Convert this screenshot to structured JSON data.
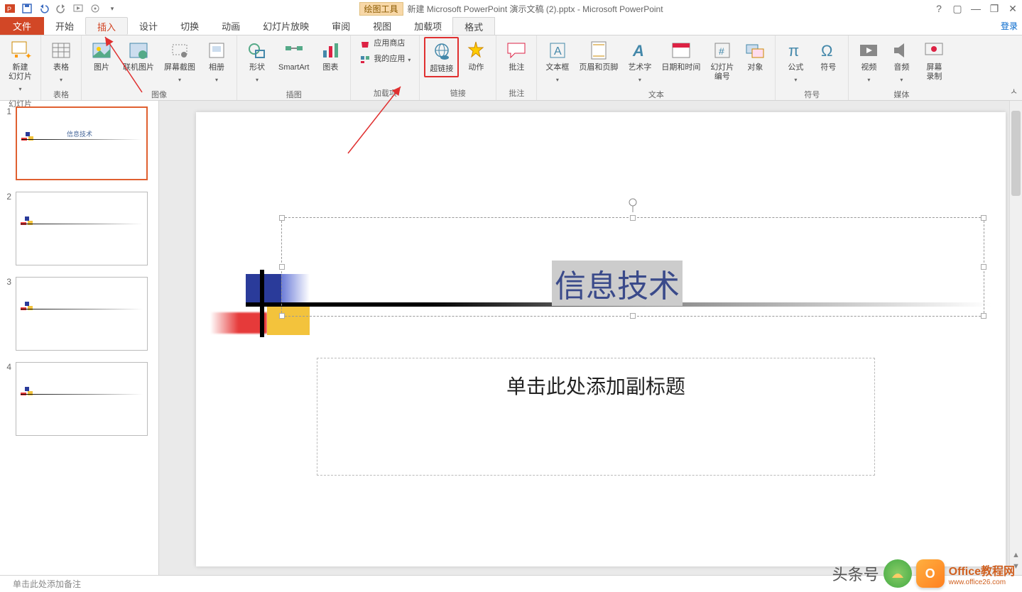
{
  "titlebar": {
    "contextual_label": "绘图工具",
    "doc_title": "新建 Microsoft PowerPoint 演示文稿 (2).pptx - Microsoft PowerPoint"
  },
  "tabs": {
    "file": "文件",
    "home": "开始",
    "insert": "插入",
    "design": "设计",
    "transitions": "切换",
    "animations": "动画",
    "slideshow": "幻灯片放映",
    "review": "审阅",
    "view": "视图",
    "addins": "加载项",
    "format": "格式",
    "login": "登录"
  },
  "ribbon": {
    "groups": {
      "slides": {
        "label": "幻灯片",
        "new_slide": "新建\n幻灯片"
      },
      "tables": {
        "label": "表格",
        "table": "表格"
      },
      "images": {
        "label": "图像",
        "picture": "图片",
        "online_picture": "联机图片",
        "screenshot": "屏幕截图",
        "album": "相册"
      },
      "illustrations": {
        "label": "插图",
        "shapes": "形状",
        "smartart": "SmartArt",
        "chart": "图表"
      },
      "addins": {
        "label": "加载项",
        "store": "应用商店",
        "myapps": "我的应用"
      },
      "links": {
        "label": "链接",
        "hyperlink": "超链接",
        "action": "动作"
      },
      "comments": {
        "label": "批注",
        "comment": "批注"
      },
      "text": {
        "label": "文本",
        "textbox": "文本框",
        "headerfooter": "页眉和页脚",
        "wordart": "艺术字",
        "datetime": "日期和时间",
        "slidenumber": "幻灯片\n编号",
        "object": "对象"
      },
      "symbols": {
        "label": "符号",
        "equation": "公式",
        "symbol": "符号"
      },
      "media": {
        "label": "媒体",
        "video": "视频",
        "audio": "音频",
        "screenrec": "屏幕\n录制"
      }
    }
  },
  "slide": {
    "title_text": "信息技术",
    "subtitle_placeholder": "单击此处添加副标题",
    "thumb_title": "信息技术"
  },
  "thumbs": {
    "count": 4,
    "numbers": [
      "1",
      "2",
      "3",
      "4"
    ]
  },
  "notes": {
    "placeholder": "单击此处添加备注"
  },
  "watermark": {
    "left_text": "头条号",
    "brand": "Office教程网",
    "url": "www.office26.com"
  }
}
